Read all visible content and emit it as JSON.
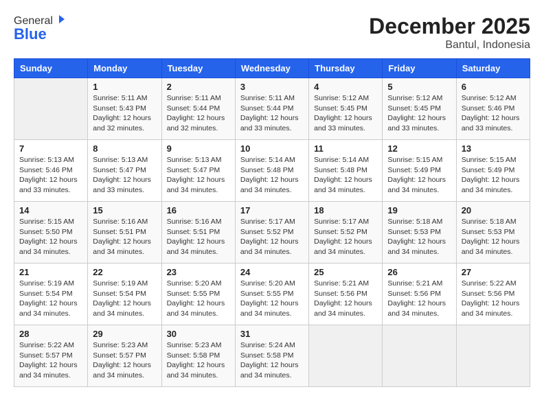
{
  "logo": {
    "general": "General",
    "blue": "Blue"
  },
  "title": "December 2025",
  "subtitle": "Bantul, Indonesia",
  "weekdays": [
    "Sunday",
    "Monday",
    "Tuesday",
    "Wednesday",
    "Thursday",
    "Friday",
    "Saturday"
  ],
  "weeks": [
    [
      {
        "day": "",
        "empty": true
      },
      {
        "day": "1",
        "sunrise": "5:11 AM",
        "sunset": "5:43 PM",
        "daylight": "12 hours and 32 minutes."
      },
      {
        "day": "2",
        "sunrise": "5:11 AM",
        "sunset": "5:44 PM",
        "daylight": "12 hours and 32 minutes."
      },
      {
        "day": "3",
        "sunrise": "5:11 AM",
        "sunset": "5:44 PM",
        "daylight": "12 hours and 33 minutes."
      },
      {
        "day": "4",
        "sunrise": "5:12 AM",
        "sunset": "5:45 PM",
        "daylight": "12 hours and 33 minutes."
      },
      {
        "day": "5",
        "sunrise": "5:12 AM",
        "sunset": "5:45 PM",
        "daylight": "12 hours and 33 minutes."
      },
      {
        "day": "6",
        "sunrise": "5:12 AM",
        "sunset": "5:46 PM",
        "daylight": "12 hours and 33 minutes."
      }
    ],
    [
      {
        "day": "7",
        "sunrise": "5:13 AM",
        "sunset": "5:46 PM",
        "daylight": "12 hours and 33 minutes."
      },
      {
        "day": "8",
        "sunrise": "5:13 AM",
        "sunset": "5:47 PM",
        "daylight": "12 hours and 33 minutes."
      },
      {
        "day": "9",
        "sunrise": "5:13 AM",
        "sunset": "5:47 PM",
        "daylight": "12 hours and 34 minutes."
      },
      {
        "day": "10",
        "sunrise": "5:14 AM",
        "sunset": "5:48 PM",
        "daylight": "12 hours and 34 minutes."
      },
      {
        "day": "11",
        "sunrise": "5:14 AM",
        "sunset": "5:48 PM",
        "daylight": "12 hours and 34 minutes."
      },
      {
        "day": "12",
        "sunrise": "5:15 AM",
        "sunset": "5:49 PM",
        "daylight": "12 hours and 34 minutes."
      },
      {
        "day": "13",
        "sunrise": "5:15 AM",
        "sunset": "5:49 PM",
        "daylight": "12 hours and 34 minutes."
      }
    ],
    [
      {
        "day": "14",
        "sunrise": "5:15 AM",
        "sunset": "5:50 PM",
        "daylight": "12 hours and 34 minutes."
      },
      {
        "day": "15",
        "sunrise": "5:16 AM",
        "sunset": "5:51 PM",
        "daylight": "12 hours and 34 minutes."
      },
      {
        "day": "16",
        "sunrise": "5:16 AM",
        "sunset": "5:51 PM",
        "daylight": "12 hours and 34 minutes."
      },
      {
        "day": "17",
        "sunrise": "5:17 AM",
        "sunset": "5:52 PM",
        "daylight": "12 hours and 34 minutes."
      },
      {
        "day": "18",
        "sunrise": "5:17 AM",
        "sunset": "5:52 PM",
        "daylight": "12 hours and 34 minutes."
      },
      {
        "day": "19",
        "sunrise": "5:18 AM",
        "sunset": "5:53 PM",
        "daylight": "12 hours and 34 minutes."
      },
      {
        "day": "20",
        "sunrise": "5:18 AM",
        "sunset": "5:53 PM",
        "daylight": "12 hours and 34 minutes."
      }
    ],
    [
      {
        "day": "21",
        "sunrise": "5:19 AM",
        "sunset": "5:54 PM",
        "daylight": "12 hours and 34 minutes."
      },
      {
        "day": "22",
        "sunrise": "5:19 AM",
        "sunset": "5:54 PM",
        "daylight": "12 hours and 34 minutes."
      },
      {
        "day": "23",
        "sunrise": "5:20 AM",
        "sunset": "5:55 PM",
        "daylight": "12 hours and 34 minutes."
      },
      {
        "day": "24",
        "sunrise": "5:20 AM",
        "sunset": "5:55 PM",
        "daylight": "12 hours and 34 minutes."
      },
      {
        "day": "25",
        "sunrise": "5:21 AM",
        "sunset": "5:56 PM",
        "daylight": "12 hours and 34 minutes."
      },
      {
        "day": "26",
        "sunrise": "5:21 AM",
        "sunset": "5:56 PM",
        "daylight": "12 hours and 34 minutes."
      },
      {
        "day": "27",
        "sunrise": "5:22 AM",
        "sunset": "5:56 PM",
        "daylight": "12 hours and 34 minutes."
      }
    ],
    [
      {
        "day": "28",
        "sunrise": "5:22 AM",
        "sunset": "5:57 PM",
        "daylight": "12 hours and 34 minutes."
      },
      {
        "day": "29",
        "sunrise": "5:23 AM",
        "sunset": "5:57 PM",
        "daylight": "12 hours and 34 minutes."
      },
      {
        "day": "30",
        "sunrise": "5:23 AM",
        "sunset": "5:58 PM",
        "daylight": "12 hours and 34 minutes."
      },
      {
        "day": "31",
        "sunrise": "5:24 AM",
        "sunset": "5:58 PM",
        "daylight": "12 hours and 34 minutes."
      },
      {
        "day": "",
        "empty": true
      },
      {
        "day": "",
        "empty": true
      },
      {
        "day": "",
        "empty": true
      }
    ]
  ]
}
